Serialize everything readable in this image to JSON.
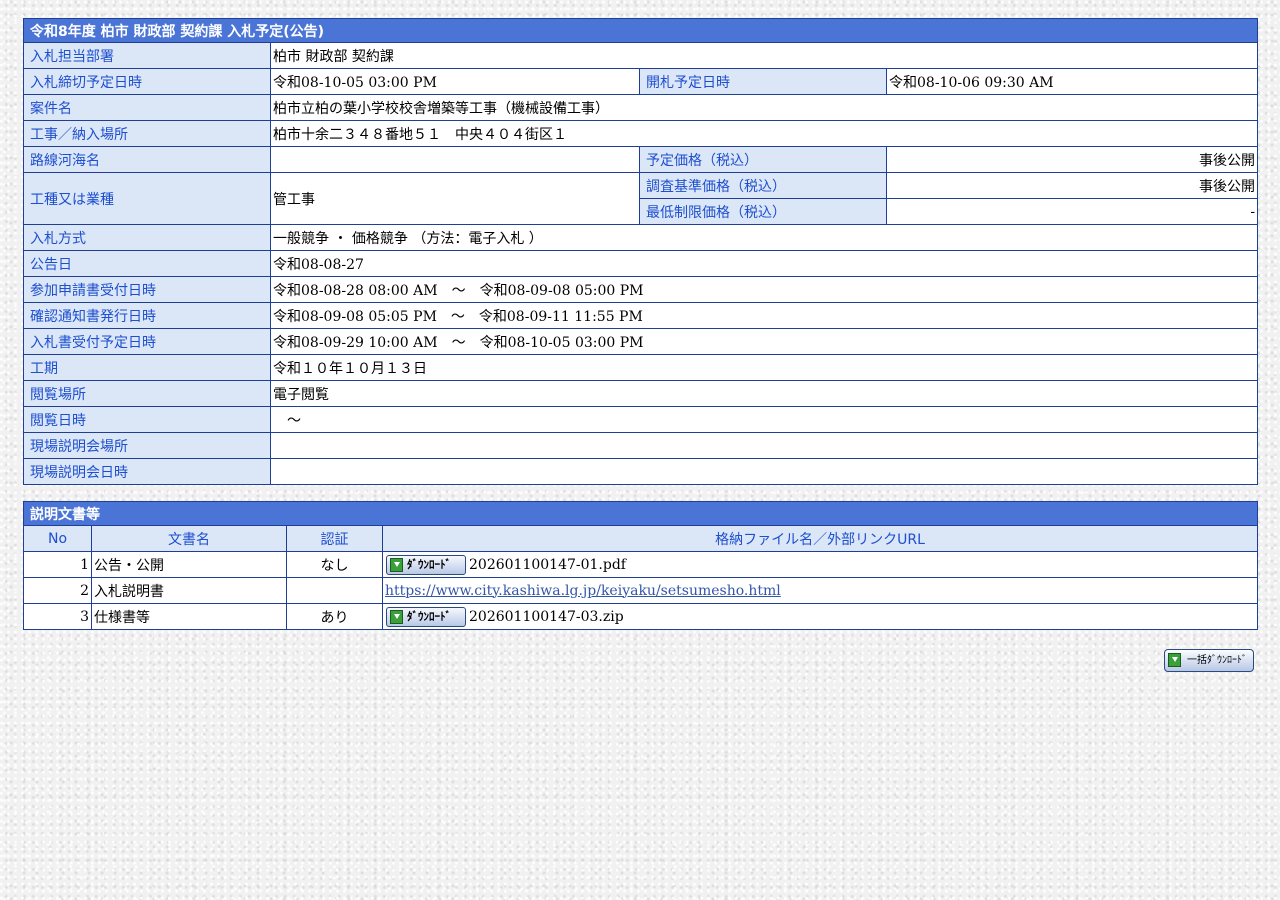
{
  "notice": {
    "title": "令和8年度 柏市 財政部 契約課 入札予定(公告)",
    "rows": {
      "dept_label": "入札担当部署",
      "dept_value": "柏市 財政部 契約課",
      "deadline_label": "入札締切予定日時",
      "deadline_value": "令和08-10-05 03:00 PM",
      "opening_label": "開札予定日時",
      "opening_value": "令和08-10-06 09:30 AM",
      "name_label": "案件名",
      "name_value": "柏市立柏の葉小学校校舎増築等工事（機械設備工事）",
      "place_label": "工事／納入場所",
      "place_value": "柏市十余二３４８番地５１　中央４０４街区１",
      "route_label": "路線河海名",
      "route_value": "",
      "planned_price_label": "予定価格（税込）",
      "planned_price_value": "事後公開",
      "type_label": "工種又は業種",
      "type_value": "管工事",
      "survey_price_label": "調査基準価格（税込）",
      "survey_price_value": "事後公開",
      "min_price_label": "最低制限価格（税込）",
      "min_price_value": "-",
      "method_label": "入札方式",
      "method_value": "一般競争 ・ 価格競争 （方法：電子入札 ）",
      "announce_label": "公告日",
      "announce_value": "令和08-08-27",
      "apply_label": "参加申請書受付日時",
      "apply_value": "令和08-08-28 08:00 AM　～　令和08-09-08 05:00 PM",
      "confirm_label": "確認通知書発行日時",
      "confirm_value": "令和08-09-08 05:05 PM　～　令和08-09-11 11:55 PM",
      "receive_label": "入札書受付予定日時",
      "receive_value": "令和08-09-29 10:00 AM　～　令和08-10-05 03:00 PM",
      "period_label": "工期",
      "period_value": "令和１０年１０月１３日",
      "view_place_label": "閲覧場所",
      "view_place_value": "電子閲覧",
      "view_time_label": "閲覧日時",
      "view_time_value": "　～",
      "site_place_label": "現場説明会場所",
      "site_place_value": "",
      "site_time_label": "現場説明会日時",
      "site_time_value": ""
    }
  },
  "docs": {
    "title": "説明文書等",
    "headers": {
      "no": "No",
      "name": "文書名",
      "auth": "認証",
      "file": "格納ファイル名／外部リンクURL"
    },
    "download_label": "ﾀﾞｳﾝﾛｰﾄﾞ",
    "items": [
      {
        "no": "1",
        "name": "公告・公開",
        "auth": "なし",
        "file": "202601100147-01.pdf"
      },
      {
        "no": "2",
        "name": "入札説明書",
        "auth": "",
        "url": "https://www.city.kashiwa.lg.jp/keiyaku/setsumesho.html"
      },
      {
        "no": "3",
        "name": "仕様書等",
        "auth": "あり",
        "file": "202601100147-03.zip"
      }
    ]
  },
  "bulk_download_label": "一括ﾀﾞｳﾝﾛｰﾄﾞ",
  "colors": {
    "header_bg": "#4a74d6",
    "label_bg": "#dbe6f6",
    "label_text": "#1d4fd0",
    "border": "#1f3e96"
  }
}
